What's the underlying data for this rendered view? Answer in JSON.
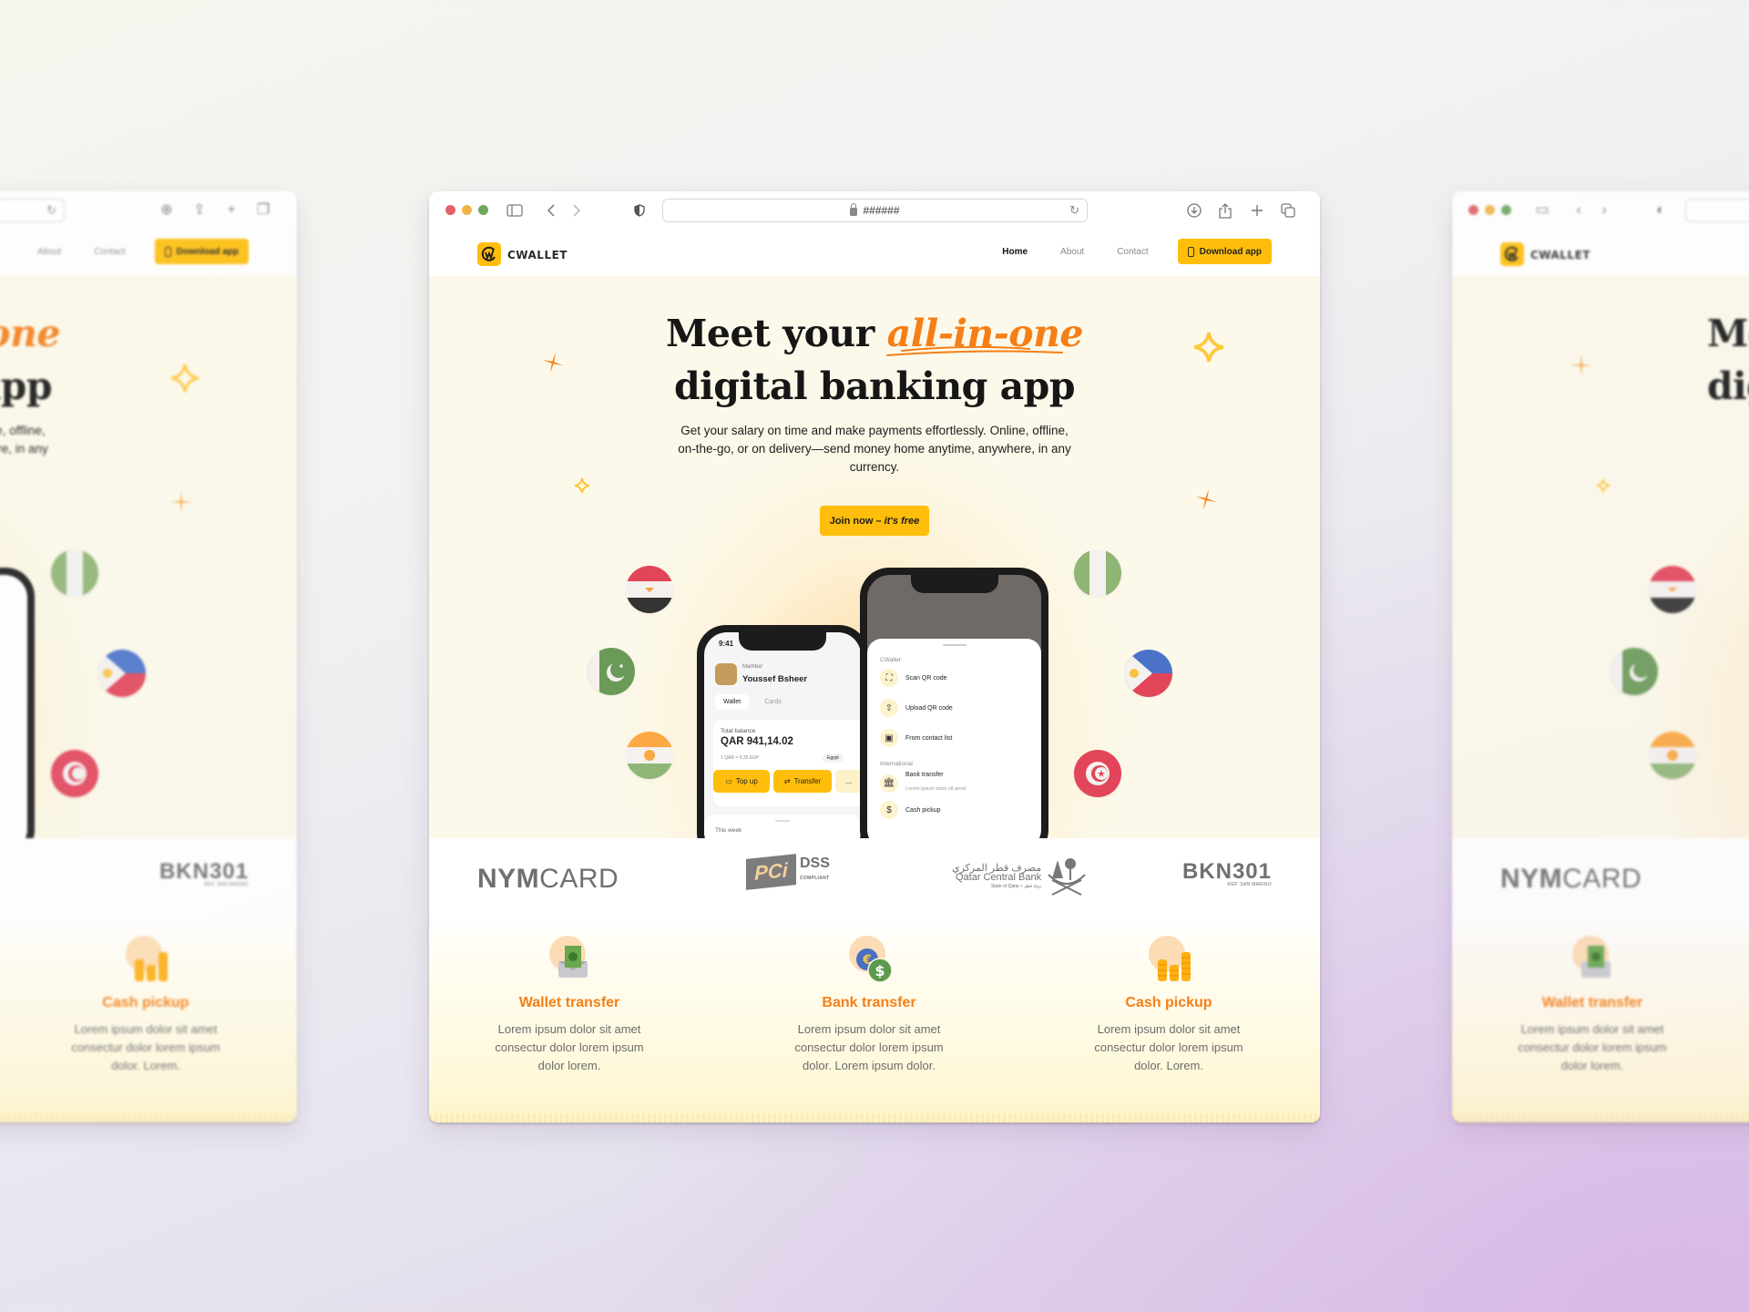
{
  "browser": {
    "url": "######",
    "controls": {
      "sidebar": "sidebar-toggle-icon",
      "back": "chevron-left-icon",
      "forward": "chevron-right-icon",
      "privacy": "shield-icon",
      "reload": "reload-icon",
      "download": "download-icon",
      "share": "share-icon",
      "new_tab": "plus-icon",
      "tabs": "tabs-overview-icon"
    }
  },
  "site": {
    "brand": "cwallet",
    "nav": [
      {
        "label": "Home",
        "active": true
      },
      {
        "label": "About",
        "active": false
      },
      {
        "label": "Contact",
        "active": false
      }
    ],
    "download_label": "Download app",
    "colors": {
      "accent": "#ffbe0b",
      "highlight": "#f57f17",
      "text": "#161616"
    }
  },
  "hero": {
    "title_prefix": "Meet your",
    "title_highlight": "all-in-one",
    "title_line2": "digital banking app",
    "subtitle": "Get your salary on time and make payments effortlessly. Online, offline, on-the-go, or on delivery—send money home anytime, anywhere, in any currency.",
    "cta_main": "Join now –",
    "cta_em": "it's free",
    "flags": [
      "Egypt",
      "Pakistan",
      "Niger",
      "Nigeria",
      "Philippines",
      "Tunisia"
    ]
  },
  "phone_wallet": {
    "time": "9:41",
    "greeting": "Marhba!",
    "user_name": "Youssef Bsheer",
    "tabs": [
      "Wallet",
      "Cards"
    ],
    "balance_label": "Total balance",
    "balance": "QAR 941,14.02",
    "rate": "1 QAR = 5.25 EGP",
    "country": "Egypt",
    "actions": [
      "Top up",
      "Transfer",
      "…"
    ],
    "section": "This week"
  },
  "phone_sheet": {
    "section1": "CWallet",
    "items1": [
      {
        "label": "Scan QR code",
        "icon": "scan-icon"
      },
      {
        "label": "Upload QR code",
        "icon": "upload-icon"
      },
      {
        "label": "From contact list",
        "icon": "contact-icon"
      }
    ],
    "section2": "International",
    "items2": [
      {
        "label": "Bank transfer",
        "sub": "Lorem ipsum dolor sit amet",
        "icon": "bank-icon"
      },
      {
        "label": "Cash pickup",
        "sub": "",
        "icon": "cash-icon"
      }
    ]
  },
  "partners": {
    "nymcard_bold": "NYM",
    "nymcard_light": "CARD",
    "pci": "PCi",
    "pci_dss": "DSS",
    "pci_compliant": "COMPLIANT",
    "qcb_arabic": "مصرف قطر المركزي",
    "qcb_english": "Qatar Central Bank",
    "qcb_state": "State of Qatar • دولة قطر",
    "bkn": "BKN301",
    "bkn_sub": "REP. SAN MARINO"
  },
  "features": [
    {
      "title": "Wallet transfer",
      "desc": "Lorem ipsum dolor sit amet consectur dolor lorem ipsum dolor lorem.",
      "icon": "envelope-money-icon"
    },
    {
      "title": "Bank transfer",
      "desc": "Lorem ipsum dolor sit amet consectur dolor lorem ipsum dolor. Lorem ipsum dolor.",
      "icon": "currency-exchange-icon"
    },
    {
      "title": "Cash pickup",
      "desc": "Lorem ipsum dolor sit amet consectur dolor lorem ipsum dolor. Lorem.",
      "icon": "coin-stacks-icon"
    }
  ]
}
